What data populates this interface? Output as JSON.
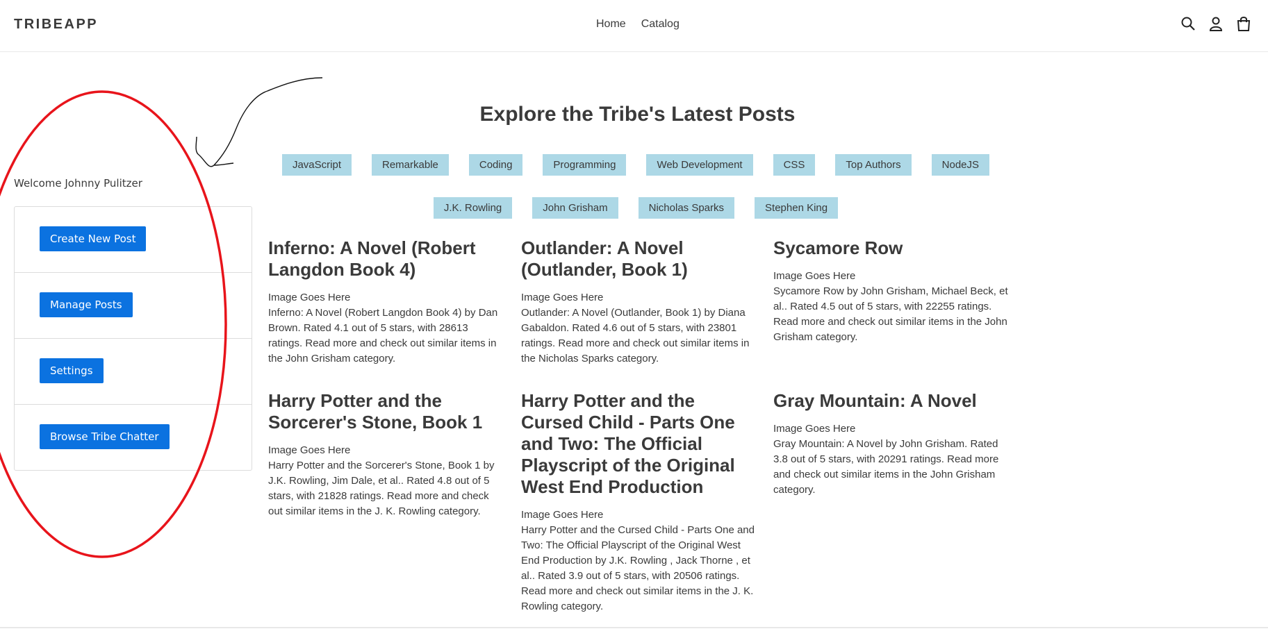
{
  "header": {
    "logo": "TRIBEAPP",
    "nav": [
      "Home",
      "Catalog"
    ],
    "icons": [
      "search-icon",
      "account-icon",
      "cart-icon"
    ]
  },
  "sidebar": {
    "welcome": "Welcome Johnny Pulitzer",
    "buttons": [
      "Create New Post",
      "Manage Posts",
      "Settings",
      "Browse Tribe Chatter"
    ]
  },
  "main": {
    "title": "Explore the Tribe's Latest Posts",
    "tags_row1": [
      "JavaScript",
      "Remarkable",
      "Coding",
      "Programming",
      "Web Development",
      "CSS",
      "Top Authors",
      "NodeJS"
    ],
    "tags_row2": [
      "J.K. Rowling",
      "John Grisham",
      "Nicholas Sparks",
      "Stephen King"
    ],
    "posts": [
      {
        "title": "Inferno: A Novel (Robert Langdon Book 4)",
        "image": "Image Goes Here",
        "desc": "Inferno: A Novel (Robert Langdon Book 4) by Dan Brown. Rated 4.1 out of 5 stars, with 28613 ratings. Read more and check out similar items in the John Grisham category."
      },
      {
        "title": "Outlander: A Novel (Outlander, Book 1)",
        "image": "Image Goes Here",
        "desc": "Outlander: A Novel (Outlander, Book 1) by Diana Gabaldon. Rated 4.6 out of 5 stars, with 23801 ratings. Read more and check out similar items in the Nicholas Sparks category."
      },
      {
        "title": "Sycamore Row",
        "image": "Image Goes Here",
        "desc": "Sycamore Row by John Grisham, Michael Beck, et al.. Rated 4.5 out of 5 stars, with 22255 ratings. Read more and check out similar items in the John Grisham category."
      },
      {
        "title": "Harry Potter and the Sorcerer's Stone, Book 1",
        "image": "Image Goes Here",
        "desc": "Harry Potter and the Sorcerer's Stone, Book 1 by J.K. Rowling, Jim Dale, et al.. Rated 4.8 out of 5 stars, with 21828 ratings. Read more and check out similar items in the J. K. Rowling category."
      },
      {
        "title": "Harry Potter and the Cursed Child - Parts One and Two: The Official Playscript of the Original West End Production",
        "image": "Image Goes Here",
        "desc": "Harry Potter and the Cursed Child - Parts One and Two: The Official Playscript of the Original West End Production by J.K. Rowling , Jack Thorne , et al.. Rated 3.9 out of 5 stars, with 20506 ratings. Read more and check out similar items in the J. K. Rowling category."
      },
      {
        "title": "Gray Mountain: A Novel",
        "image": "Image Goes Here",
        "desc": "Gray Mountain: A Novel by John Grisham. Rated 3.8 out of 5 stars, with 20291 ratings. Read more and check out similar items in the John Grisham category."
      }
    ]
  },
  "colors": {
    "button_blue": "#0b72e0",
    "tag_bg": "#add8e6",
    "annotation_red": "#e8141b"
  }
}
